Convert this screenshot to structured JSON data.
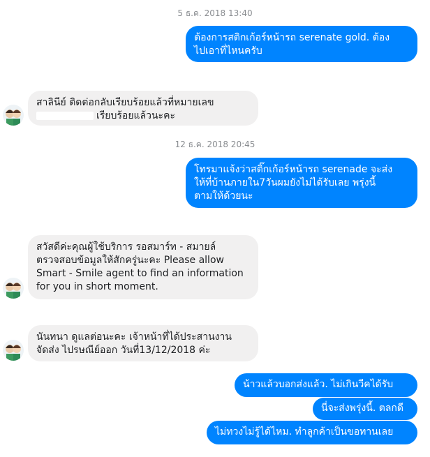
{
  "timestamps": [
    "5 ธ.ค. 2018 13:40",
    "12 ธ.ค. 2018 20:45"
  ],
  "messages": [
    {
      "lines": [
        "ต้องการสติกเก้อร์หน้ารถ serenate gold. ต้อง",
        "ไปเอาที่ไหนครับ"
      ]
    },
    {
      "lines": [
        "สาลินีย์ ติดต่อกลับเรียบร้อยแล้วที่หมายเลข",
        "เรียบร้อยแล้วนะคะ"
      ]
    },
    {
      "lines": [
        "โทรมาแจ้งว่าสติ๊กเก้อร์หน้ารถ serenade จะส่ง",
        "ให้ที่บ้านภายใน7วันผมยังไม่ได้รับเลย พรุ่งนี้",
        "ตามให้ด้วยนะ"
      ]
    },
    {
      "lines": [
        "สวัสดีค่ะคุณผู้ใช้บริการ รอสมาร์ท - สมายล์",
        "ตรวจสอบข้อมูลให้สักครู่นะคะ  Please allow",
        "Smart - Smile agent to find an information",
        "for you in short moment."
      ]
    },
    {
      "lines": [
        "นันทนา ดูแลต่อนะคะ เจ้าหน้าที่ได้ประสานงาน",
        "จัดส่ง   ไปรษณีย์ออก วันที่13/12/2018 ค่ะ"
      ]
    },
    {
      "lines": [
        "น้าวแล้วบอกส่งแล้ว. ไม่เกินวีคได้รับ"
      ]
    },
    {
      "lines": [
        "นี่จะส่งพรุ่งนี้. ตลกดี"
      ]
    },
    {
      "lines": [
        "ไม่ทวงไม่รู้ได้ไหม. ทำลูกค้าเป็นขอทานเลย"
      ]
    }
  ],
  "colors": {
    "outgoing": "#0084ff",
    "incoming": "#f1f0f0",
    "timestamp": "#8a8d91"
  },
  "avatar_icon": "cartoon-couple-avatar"
}
